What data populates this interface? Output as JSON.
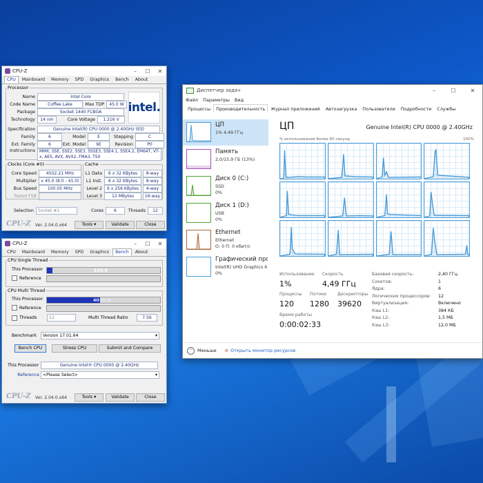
{
  "cpuz1": {
    "title": "CPU-Z",
    "tabs": [
      "CPU",
      "Mainboard",
      "Memory",
      "SPD",
      "Graphics",
      "Bench",
      "About"
    ],
    "processor_legend": "Processor",
    "name_label": "Name",
    "name": "Intel Core",
    "codename_label": "Code Name",
    "codename": "Coffee Lake",
    "maxtdp_label": "Max TDP",
    "maxtdp": "45.0 W",
    "package_label": "Package",
    "package": "Socket 1440 FCBGA",
    "tech_label": "Technology",
    "tech": "14 nm",
    "corevolt_label": "Core Voltage",
    "corevolt": "1.216 V",
    "logo": "intel.",
    "spec_label": "Specification",
    "spec": "Genuine Intel(R) CPU 0000 @ 2.40GHz (ES)",
    "family_label": "Family",
    "family": "6",
    "model_label": "Model",
    "model": "E",
    "stepping_label": "Stepping",
    "stepping": "C",
    "extfamily_label": "Ext. Family",
    "extfamily": "6",
    "extmodel_label": "Ext. Model",
    "extmodel": "9E",
    "revision_label": "Revision",
    "revision": "P0",
    "instr_label": "Instructions",
    "instr": "MMX, SSE, SSE2, SSE3, SSSE3, SSE4.1, SSE4.2, EM64T, VT-x, AES, AVX, AVX2, FMA3, TSX",
    "clocks_legend": "Clocks (Core #0)",
    "corespeed_label": "Core Speed",
    "corespeed": "4502.21 MHz",
    "multiplier_label": "Multiplier",
    "multiplier": "x 45.0 (8.0 - 41.0)",
    "busspeed_label": "Bus Speed",
    "busspeed": "100.05 MHz",
    "ratedfsb_label": "Rated FSB",
    "ratedfsb": "",
    "cache_legend": "Cache",
    "l1d_label": "L1 Data",
    "l1d": "6 x 32 KBytes",
    "l1d_way": "8-way",
    "l1i_label": "L1 Inst.",
    "l1i": "6 x 32 KBytes",
    "l1i_way": "8-way",
    "l2_label": "Level 2",
    "l2": "6 x 256 KBytes",
    "l2_way": "4-way",
    "l3_label": "Level 3",
    "l3": "12 MBytes",
    "l3_way": "16-way",
    "selection_label": "Selection",
    "selection": "Socket #1",
    "cores_label": "Cores",
    "cores": "6",
    "threads_label": "Threads",
    "threads": "12",
    "brand": "CPU-Z",
    "version": "Ver. 2.04.0.x64",
    "tools": "Tools",
    "validate": "Validate",
    "close": "Close"
  },
  "cpuz2": {
    "title": "CPU-Z",
    "tabs": [
      "CPU",
      "Mainboard",
      "Memory",
      "SPD",
      "Graphics",
      "Bench",
      "About"
    ],
    "single_legend": "CPU Single Thread",
    "this_processor": "This Processor",
    "reference": "Reference",
    "single_value": "530.8",
    "single_fraction": 0.05,
    "multi_legend": "CPU Multi Thread",
    "multi_value": "4010.5",
    "multi_fraction": 0.47,
    "threads_label": "Threads",
    "threads": "12",
    "ratio_label": "Multi Thread Ratio",
    "ratio": "7.56",
    "benchmark_label": "Benchmark",
    "benchmark": "Version 17.01.64",
    "bench_cpu": "Bench CPU",
    "stress_cpu": "Stress CPU",
    "submit": "Submit and Compare",
    "this_proc_label": "This Processor",
    "this_proc": "Genuine Intel® CPU 0000 @ 2.40GHz",
    "reference_label": "Reference",
    "reference_select": "<Please Select>",
    "brand": "CPU-Z",
    "version": "Ver. 2.04.0.x64",
    "tools": "Tools",
    "validate": "Validate",
    "close": "Close"
  },
  "tm": {
    "title": "Диспетчер задач",
    "menu": [
      "Файл",
      "Параметры",
      "Вид"
    ],
    "tabs": [
      "Процессы",
      "Производительность",
      "Журнал приложений",
      "Автозагрузка",
      "Пользователи",
      "Подробности",
      "Службы"
    ],
    "resources": [
      {
        "name": "ЦП",
        "sub1": "1% 4,49 ГГц",
        "sub2": ""
      },
      {
        "name": "Память",
        "sub1": "2,0/15,9 ГБ (13%)",
        "sub2": ""
      },
      {
        "name": "Диск 0 (C:)",
        "sub1": "SSD",
        "sub2": "0%"
      },
      {
        "name": "Диск 1 (D:)",
        "sub1": "USB",
        "sub2": "0%"
      },
      {
        "name": "Ethernet",
        "sub1": "Ethernet",
        "sub2": "О: 0 П: 0 кбит/с"
      },
      {
        "name": "Графический про",
        "sub1": "Intel(R) UHD Graphics 6",
        "sub2": "0%"
      }
    ],
    "heading": "ЦП",
    "model": "Genuine Intel(R) CPU 0000 @ 2.40GHz",
    "hint": "% использования более 60 секунд",
    "pct": "100%",
    "usage_label": "Использование",
    "usage": "1%",
    "speed_label": "Скорость",
    "speed": "4,49 ГГц",
    "proc_label": "Процессы",
    "proc": "120",
    "threads_label": "Потоки",
    "threads": "1280",
    "handles_label": "Дескрипторы",
    "handles": "39620",
    "uptime_label": "Время работы",
    "uptime": "0:00:02:33",
    "kv": [
      [
        "Базовая скорость:",
        "2,40 ГГц"
      ],
      [
        "Сокетов:",
        "1"
      ],
      [
        "Ядра:",
        "6"
      ],
      [
        "Логических процессоров:",
        "12"
      ],
      [
        "Виртуализация:",
        "Включено"
      ],
      [
        "Кэш L1:",
        "384 КБ"
      ],
      [
        "Кэш L2:",
        "1,5 МБ"
      ],
      [
        "Кэш L3:",
        "12,0 МБ"
      ]
    ],
    "less": "Меньше",
    "monitor": "Открыть монитор ресурсов"
  },
  "colors": {
    "accent": "#1a5fc4",
    "bench_fill": "#1f35b8",
    "cpu_line": "#4a9bd8"
  }
}
